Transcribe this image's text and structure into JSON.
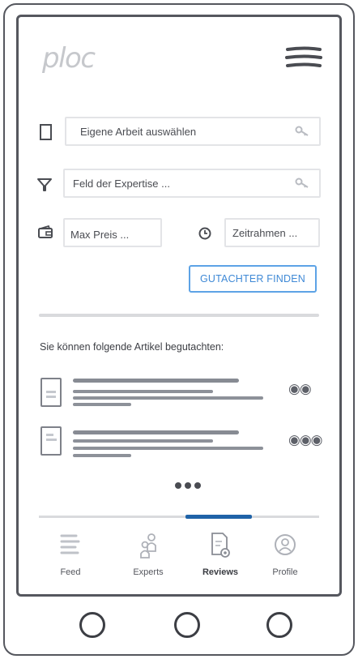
{
  "app": {
    "logo_text": "ploc"
  },
  "search": {
    "work_placeholder": "Eigene Arbeit auswählen",
    "expertise_placeholder": "Feld der Expertise ...",
    "max_price_placeholder": "Max Preis ...",
    "timeframe_placeholder": "Zeitrahmen ...",
    "find_button_label": "GUTACHTER FINDEN"
  },
  "articles": {
    "section_label": "Sie können folgende Artikel begutachten:",
    "items": [
      {
        "review_coins": "◉◉"
      },
      {
        "review_coins": "◉◉◉"
      }
    ]
  },
  "tabs": {
    "items": [
      {
        "label": "Feed",
        "icon": "feed-icon"
      },
      {
        "label": "Experts",
        "icon": "experts-icon"
      },
      {
        "label": "Reviews",
        "icon": "reviews-icon"
      },
      {
        "label": "Profile",
        "icon": "profile-icon"
      }
    ],
    "active": "Reviews"
  },
  "colors": {
    "accent": "#3f89d6",
    "active_tab": "#1f63a8",
    "frame": "#55575e"
  }
}
